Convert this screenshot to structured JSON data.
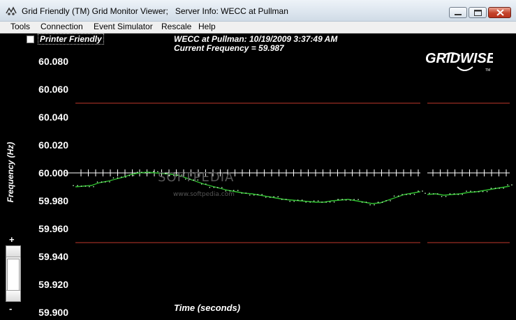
{
  "window": {
    "title": "Grid Friendly (TM) Grid Monitor Viewer;   Server Info: WECC at Pullman",
    "buttons": [
      "minimize",
      "maximize",
      "close"
    ]
  },
  "menu": [
    "Tools",
    "Connection",
    "Event Simulator",
    "Rescale",
    "Help"
  ],
  "printer_friendly": {
    "label": "Printer Friendly",
    "checked": false
  },
  "info": {
    "line1": "WECC at Pullman: 10/19/2009 3:37:49 AM",
    "line2": "Current Frequency = 59.987"
  },
  "logo": {
    "text": "GRIDWISE",
    "trademark": "TM"
  },
  "watermark": {
    "text": "SOFTPEDIA",
    "url": "www.softpedia.com"
  },
  "zoom": {
    "plus": "+",
    "minus": "-"
  },
  "chart_data": {
    "type": "line",
    "ylabel": "Frequency (Hz)",
    "xlabel": "Time (seconds)",
    "ylim": [
      59.9,
      60.09
    ],
    "yticks": [
      "60.080",
      "60.060",
      "60.040",
      "60.020",
      "60.000",
      "59.980",
      "59.960",
      "59.940",
      "59.920",
      "59.900"
    ],
    "limit_lines": [
      60.05,
      59.95
    ],
    "nominal": 60.0,
    "line_color": "#2fbf2f",
    "limit_color": "#c0392b",
    "series": [
      {
        "values": [
          59.99,
          59.9905,
          59.991,
          59.993,
          59.994,
          59.9955,
          59.997,
          59.999,
          60.0,
          60.0005,
          60.0,
          59.9995,
          59.999,
          59.998,
          59.996,
          59.994,
          59.992,
          59.9905,
          59.989,
          59.9875,
          59.9865,
          59.9855,
          59.985,
          59.984,
          59.983,
          59.982,
          59.981,
          59.9805,
          59.98,
          59.9795,
          59.979,
          59.979,
          59.98,
          59.9805,
          59.981,
          59.98,
          59.979,
          59.978,
          59.9785,
          59.9805,
          59.9825,
          59.9845,
          59.9855,
          59.9865
        ],
        "values2": [
          59.9845,
          59.985,
          59.984,
          59.9845,
          59.985,
          59.986,
          59.9865,
          59.9875,
          59.9885,
          59.9895,
          59.9905
        ]
      }
    ]
  }
}
